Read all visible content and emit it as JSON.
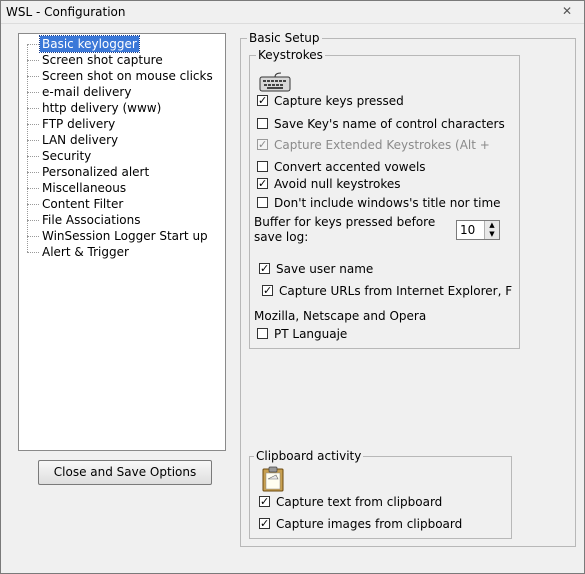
{
  "window": {
    "title": "WSL - Configuration",
    "close_glyph": "✕"
  },
  "tree": {
    "items": [
      {
        "label": "Basic keylogger",
        "selected": true
      },
      {
        "label": "Screen shot capture"
      },
      {
        "label": "Screen shot on mouse clicks"
      },
      {
        "label": "e-mail delivery"
      },
      {
        "label": "http delivery (www)"
      },
      {
        "label": "FTP delivery"
      },
      {
        "label": "LAN delivery"
      },
      {
        "label": "Security"
      },
      {
        "label": "Personalized alert"
      },
      {
        "label": "Miscellaneous"
      },
      {
        "label": "Content Filter"
      },
      {
        "label": "File Associations"
      },
      {
        "label": "WinSession Logger Start up"
      },
      {
        "label": "Alert & Trigger"
      }
    ]
  },
  "buttons": {
    "close_save": "Close and Save Options"
  },
  "basic_setup": {
    "legend": "Basic Setup",
    "keystrokes": {
      "legend": "Keystrokes",
      "icon": "keyboard-icon",
      "options": [
        {
          "label": "Capture keys pressed",
          "checked": true
        },
        {
          "label": "Save Key's name of control characters",
          "checked": false
        },
        {
          "label": "Capture Extended Keystrokes (Alt +",
          "checked": true,
          "disabled": true
        },
        {
          "label": "Convert accented vowels",
          "checked": false
        },
        {
          "label": "Avoid null keystrokes",
          "checked": true
        },
        {
          "label": "Don't include windows's title nor time",
          "checked": false
        }
      ],
      "buffer_label_1": "Buffer for keys pressed before",
      "buffer_label_2": "save log:",
      "buffer_value": "10",
      "save_user_name": {
        "label": "Save user name",
        "checked": true
      },
      "capture_urls": {
        "label": "Capture URLs from Internet Explorer, Firefo",
        "checked": true
      },
      "browsers_note": "Mozilla, Netscape and Opera",
      "pt_language": {
        "label": "PT Languaje",
        "checked": false
      }
    },
    "clipboard": {
      "legend": "Clipboard activity",
      "icon": "clipboard-icon",
      "capture_text": {
        "label": "Capture text from clipboard",
        "checked": true
      },
      "capture_images": {
        "label": "Capture images from clipboard",
        "checked": true
      }
    }
  }
}
